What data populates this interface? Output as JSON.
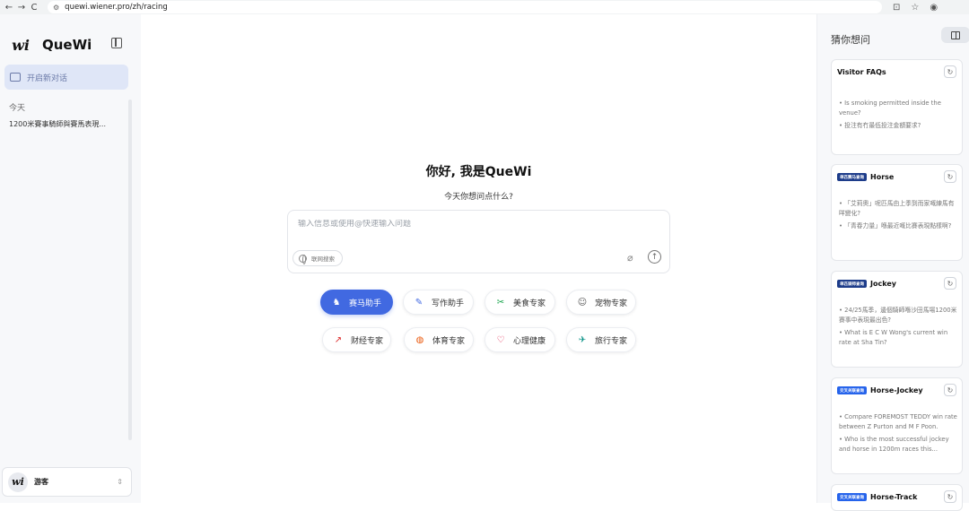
{
  "browser": {
    "url": "quewi.wiener.pro/zh/racing",
    "back": "←",
    "forward": "→",
    "reload": "C"
  },
  "sidebar": {
    "brand": "QueWi",
    "new_chat": "开启新对话",
    "section_today": "今天",
    "history": [
      "1200米賽事騎師與賽馬表現..."
    ],
    "user_name": "游客"
  },
  "main": {
    "greeting": "你好, 我是QueWi",
    "subgreeting": "今天你想问点什么?",
    "input_placeholder": "输入信息或使用@快速输入问题",
    "web_search": "联网搜索",
    "chips": [
      {
        "label": "赛马助手",
        "icon": "horse-icon",
        "active": true
      },
      {
        "label": "写作助手",
        "icon": "pen-icon",
        "active": false
      },
      {
        "label": "美食专家",
        "icon": "food-icon",
        "active": false
      },
      {
        "label": "宠物专家",
        "icon": "pet-icon",
        "active": false
      },
      {
        "label": "财经专家",
        "icon": "finance-icon",
        "active": false
      },
      {
        "label": "体育专家",
        "icon": "ball-icon",
        "active": false
      },
      {
        "label": "心理健康",
        "icon": "heart-icon",
        "active": false
      },
      {
        "label": "旅行专家",
        "icon": "plane-icon",
        "active": false
      }
    ],
    "accent_color": "#4169e1"
  },
  "right_panel": {
    "title": "猜你想问",
    "cards": [
      {
        "title": "Visitor FAQs",
        "tag": "",
        "items": [
          "Is smoking permitted inside the venue?",
          "投注有冇最低投注金額要求?"
        ]
      },
      {
        "title": "Horse",
        "tag": "单匹赛马查询",
        "items": [
          "「艾莉奧」呢匹馬由上季到而家嘅練馬有咩變化?",
          "「青春力量」喺最近嘅比賽表現點樣啊?"
        ]
      },
      {
        "title": "Jockey",
        "tag": "单匹骑师查询",
        "items": [
          "24/25馬季，邊個騎師喺沙田馬場1200米賽事中表現最出色?",
          "What is E C W Wong's current win rate at Sha Tin?"
        ]
      },
      {
        "title": "Horse-Jockey",
        "tag": "交叉关联查询",
        "items": [
          "Compare FOREMOST TEDDY win rate between Z Purton and M F Poon.",
          "Who is the most successful jockey and horse in 1200m races this..."
        ]
      },
      {
        "title": "Horse-Track",
        "tag": "交叉关联查询",
        "items": []
      }
    ]
  }
}
